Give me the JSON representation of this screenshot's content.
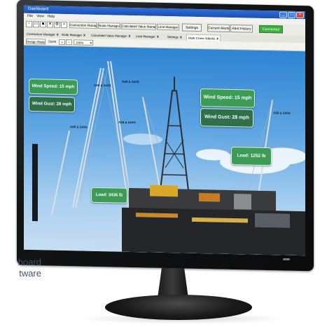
{
  "window": {
    "title": "Dashboard"
  },
  "menu": [
    "File",
    "View",
    "Help"
  ],
  "toolbar": {
    "tabs": [
      "Connection Manager",
      "Node Manager",
      "Calculated Value Manager",
      "Limit Manager"
    ],
    "settings_label": "Settings",
    "current_alerts_label": "Current Alerts",
    "alert_history_label": "Alert History",
    "status_label": "Connected"
  },
  "tabrow": {
    "tabs": [
      "Connection Manager",
      "Node Manager",
      "Calculated Value Manager",
      "Limit Manager",
      "Settings",
      "Multi-Crane 3dbolts"
    ],
    "close_glyph": "X"
  },
  "zoombar": {
    "design_mode_label": "Design Mode",
    "zoom_label": "Zoom",
    "zoom_value": "100%"
  },
  "overlays": {
    "wind_speed_left": "Wind Speed: 15 mph",
    "wind_gust_left": "Wind Gust: 28 mph",
    "wind_speed_right": "Wind Speed: 15 mph",
    "wind_gust_right": "Wind Gust: 28 mph",
    "load_right": "Load: 1252 lb",
    "load_bottom": "Load: 3436 lb"
  },
  "crane_labels": [
    "A2B & SAFE",
    "A2B & SAFE",
    "A2B & SAFE",
    "A2B & SAFE",
    "A2B & SAFE"
  ],
  "caption": {
    "line1": "board",
    "line2": "tware"
  },
  "colors": {
    "connected": "#3fae3c",
    "overlay": "#3c9b57",
    "title_bar": "#1b4fb3",
    "caption": "#44546b"
  }
}
